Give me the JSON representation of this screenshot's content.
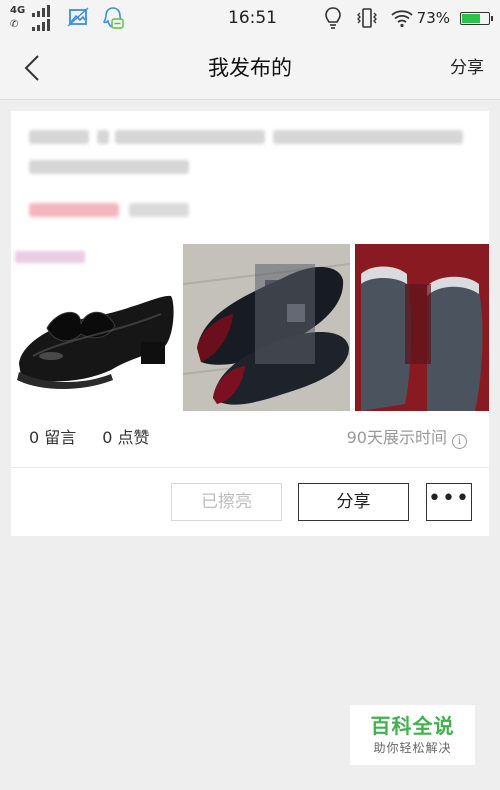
{
  "status_bar": {
    "network_top": "4G",
    "network_bottom": "✆",
    "time": "16:51",
    "battery_percent": 73,
    "battery_text": "73%"
  },
  "header": {
    "title": "我发布的",
    "share_label": "分享",
    "back_icon": "chevron-left-icon"
  },
  "listing": {
    "comments": "0 留言",
    "likes": "0 点赞",
    "display_time": "90天展示时间",
    "info_glyph": "i"
  },
  "actions": {
    "polished_label": "已擦亮",
    "share_label": "分享",
    "more_label": "•••"
  },
  "watermark": {
    "title": "百科全说",
    "subtitle": "助你轻松解决"
  },
  "colors": {
    "background": "#eeeeee",
    "accent_green": "#2bc24a",
    "watermark_green": "#3fb34a"
  }
}
